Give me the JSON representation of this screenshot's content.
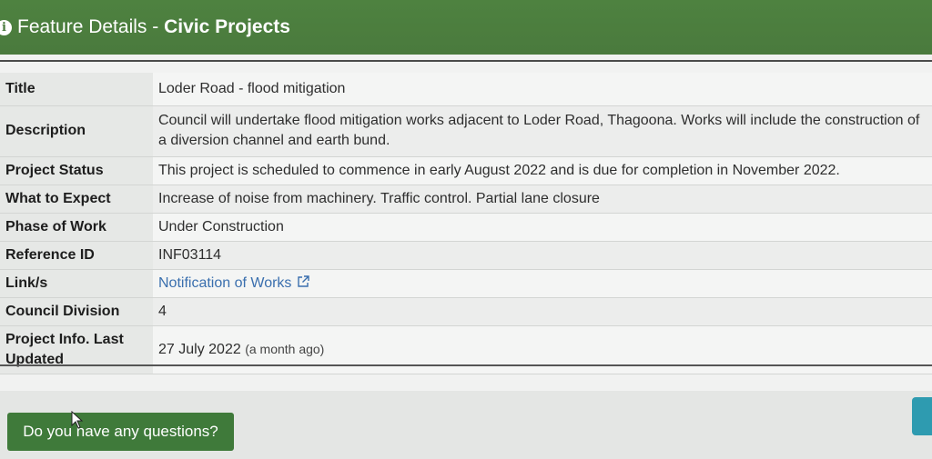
{
  "header": {
    "title_prefix": "Feature Details - ",
    "title_bold": "Civic Projects",
    "icon": "info-icon"
  },
  "details": {
    "title_label": "Title",
    "title_value": "Loder Road - flood mitigation",
    "description_label": "Description",
    "description_value": "Council will undertake flood mitigation works adjacent to Loder Road, Thagoona. Works will include the construction of a diversion channel and earth bund.",
    "status_label": "Project Status",
    "status_value": "This project is scheduled to commence in early August 2022 and is due for completion in November 2022.",
    "expect_label": "What to Expect",
    "expect_value": "Increase of noise from machinery. Traffic control. Partial lane closure",
    "phase_label": "Phase of Work",
    "phase_value": "Under Construction",
    "reference_label": "Reference ID",
    "reference_value": "INF03114",
    "links_label": "Link/s",
    "links_value": "Notification of Works",
    "division_label": "Council Division",
    "division_value": "4",
    "updated_label": "Project Info. Last Updated",
    "updated_value": "27 July 2022",
    "updated_relative": "(a month ago)"
  },
  "footer": {
    "questions_button": "Do you have any questions?"
  },
  "colors": {
    "header_green": "#4a7a3d",
    "button_green": "#3f7a3a",
    "link_blue": "#3a6fae",
    "teal": "#2e9bb0"
  }
}
